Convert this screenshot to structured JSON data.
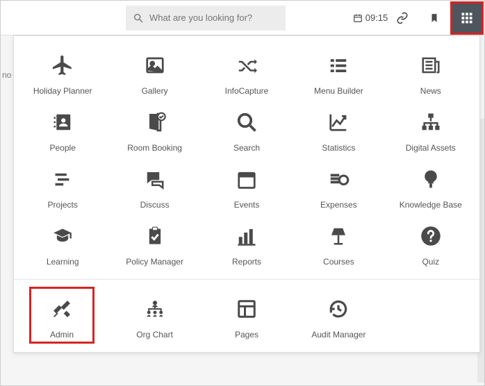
{
  "topbar": {
    "search_placeholder": "What are you looking for?",
    "time": "09:15"
  },
  "left_fragment": "no",
  "menu": {
    "rows": [
      [
        "Holiday Planner",
        "Gallery",
        "InfoCapture",
        "Menu Builder",
        "News"
      ],
      [
        "People",
        "Room Booking",
        "Search",
        "Statistics",
        "Digital Assets"
      ],
      [
        "Projects",
        "Discuss",
        "Events",
        "Expenses",
        "Knowledge Base"
      ],
      [
        "Learning",
        "Policy Manager",
        "Reports",
        "Courses",
        "Quiz"
      ]
    ],
    "bottom": [
      "Admin",
      "Org Chart",
      "Pages",
      "Audit Manager"
    ]
  }
}
